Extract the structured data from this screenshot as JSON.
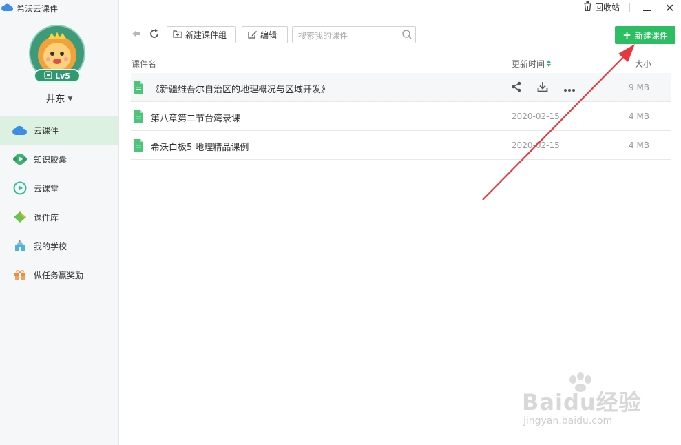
{
  "app": {
    "title": "希沃云课件"
  },
  "profile": {
    "username": "井东",
    "level": "Lv5"
  },
  "sidebar": {
    "items": [
      {
        "label": "云课件",
        "active": true
      },
      {
        "label": "知识胶囊"
      },
      {
        "label": "云课堂"
      },
      {
        "label": "课件库"
      },
      {
        "label": "我的学校"
      },
      {
        "label": "做任务赢奖励"
      }
    ]
  },
  "window": {
    "recycle_label": "回收站"
  },
  "toolbar": {
    "new_group_label": "新建课件组",
    "edit_label": "编辑",
    "search_placeholder": "搜索我的课件",
    "new_courseware_label": "新建课件"
  },
  "table": {
    "headers": {
      "name": "课件名",
      "updated": "更新时间",
      "size": "大小"
    },
    "rows": [
      {
        "name": "《新疆维吾尔自治区的地理概况与区域开发》",
        "date": "",
        "size": "9 MB"
      },
      {
        "name": "第八章第二节台湾录课",
        "date": "2020-02-15",
        "size": "4 MB"
      },
      {
        "name": "希沃白板5 地理精品课例",
        "date": "2020-02-15",
        "size": "4 MB"
      }
    ]
  },
  "watermark": {
    "brand": "Baidu经验",
    "url": "jingyan.baidu.com"
  },
  "colors": {
    "accent": "#2dbd63",
    "active_nav_bg": "#dcf1e1",
    "annotation": "#e8383d"
  }
}
